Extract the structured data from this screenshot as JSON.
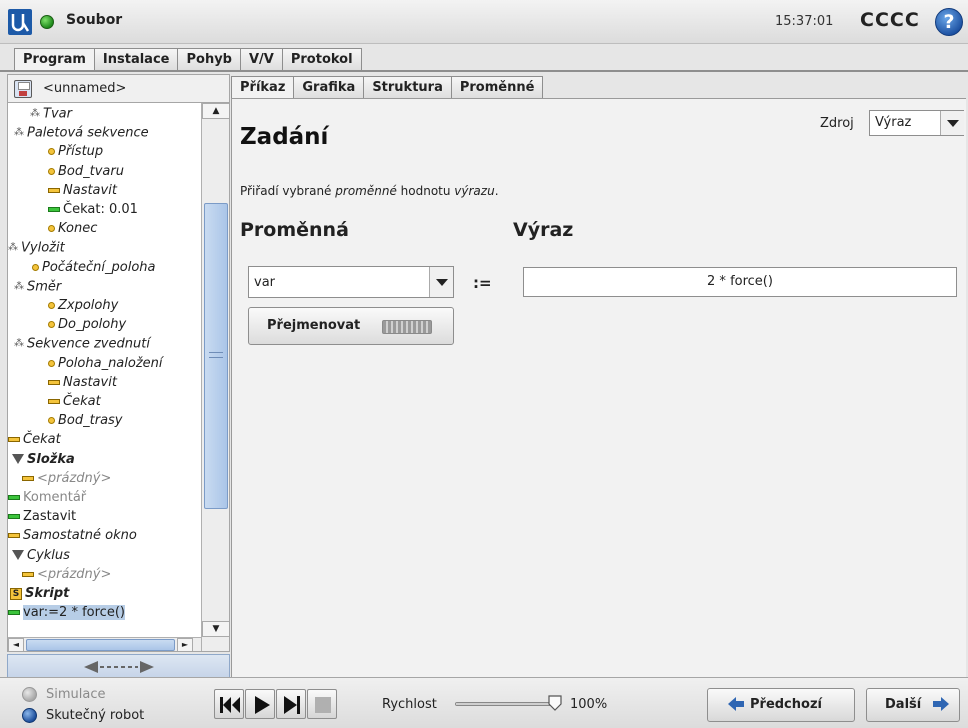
{
  "titlebar": {
    "menu_label": "Soubor",
    "time": "15:37:01",
    "robot_name": "CCCC",
    "help_symbol": "?",
    "status_color": "#2e9e24"
  },
  "main_tabs": [
    {
      "label": "Program",
      "active": true
    },
    {
      "label": "Instalace",
      "active": false
    },
    {
      "label": "Pohyb",
      "active": false
    },
    {
      "label": "V/V",
      "active": false
    },
    {
      "label": "Protokol",
      "active": false
    }
  ],
  "program": {
    "name": "<unnamed>",
    "tree": [
      {
        "label": "Tvar",
        "icon": "pallet-icon"
      },
      {
        "label": "Paletová sekvence",
        "icon": "pallet-icon"
      },
      {
        "label": "Přístup",
        "icon": "waypoint-icon"
      },
      {
        "label": "Bod_tvaru",
        "icon": "waypoint-icon"
      },
      {
        "label": "Nastavit",
        "icon": "command-icon"
      },
      {
        "label": "Čekat: 0.01",
        "icon": "command-green-icon"
      },
      {
        "label": "Konec",
        "icon": "waypoint-icon"
      },
      {
        "label": "Vyložit",
        "icon": "pallet-icon"
      },
      {
        "label": "Počáteční_poloha",
        "icon": "waypoint-icon"
      },
      {
        "label": "Směr",
        "icon": "pallet-icon"
      },
      {
        "label": "Zxpolohy",
        "icon": "waypoint-icon"
      },
      {
        "label": "Do_polohy",
        "icon": "waypoint-icon"
      },
      {
        "label": "Sekvence zvednutí",
        "icon": "pallet-icon"
      },
      {
        "label": "Poloha_naložení",
        "icon": "waypoint-icon"
      },
      {
        "label": "Nastavit",
        "icon": "command-icon"
      },
      {
        "label": "Čekat",
        "icon": "command-icon"
      },
      {
        "label": "Bod_trasy",
        "icon": "waypoint-icon"
      },
      {
        "label": "Čekat",
        "icon": "command-icon"
      },
      {
        "label": "Složka",
        "icon": "folder-icon"
      },
      {
        "label": "<prázdný>",
        "icon": "command-icon"
      },
      {
        "label": "Komentář",
        "icon": "command-green-icon"
      },
      {
        "label": "Zastavit",
        "icon": "command-green-icon"
      },
      {
        "label": "Samostatné okno",
        "icon": "command-icon"
      },
      {
        "label": "Cyklus",
        "icon": "loop-icon"
      },
      {
        "label": "<prázdný>",
        "icon": "command-icon"
      },
      {
        "label": "Skript",
        "icon": "script-icon"
      },
      {
        "label": "var:=2 * force()",
        "icon": "command-green-icon"
      }
    ],
    "collapse_label": "◄----►"
  },
  "sub_tabs": [
    {
      "label": "Příkaz",
      "active": true
    },
    {
      "label": "Grafika",
      "active": false
    },
    {
      "label": "Struktura",
      "active": false
    },
    {
      "label": "Proměnné",
      "active": false
    }
  ],
  "assignment": {
    "title": "Zadání",
    "source_label": "Zdroj",
    "source_value": "Výraz",
    "description_prefix": "Přiřadí vybrané ",
    "description_var": "proměnné",
    "description_mid": " hodnotu ",
    "description_expr": "výrazu",
    "description_suffix": ".",
    "variable_heading": "Proměnná",
    "expression_heading": "Výraz",
    "variable_value": "var",
    "assign_operator": ":=",
    "expression_value": "2 * force()",
    "rename_label": "Přejmenovat"
  },
  "footer": {
    "simulation_label": "Simulace",
    "real_robot_label": "Skutečný robot",
    "speed_label": "Rychlost",
    "speed_value": "100%",
    "speed_fraction": 1.0,
    "prev_label": "Předchozí",
    "next_label": "Další"
  }
}
